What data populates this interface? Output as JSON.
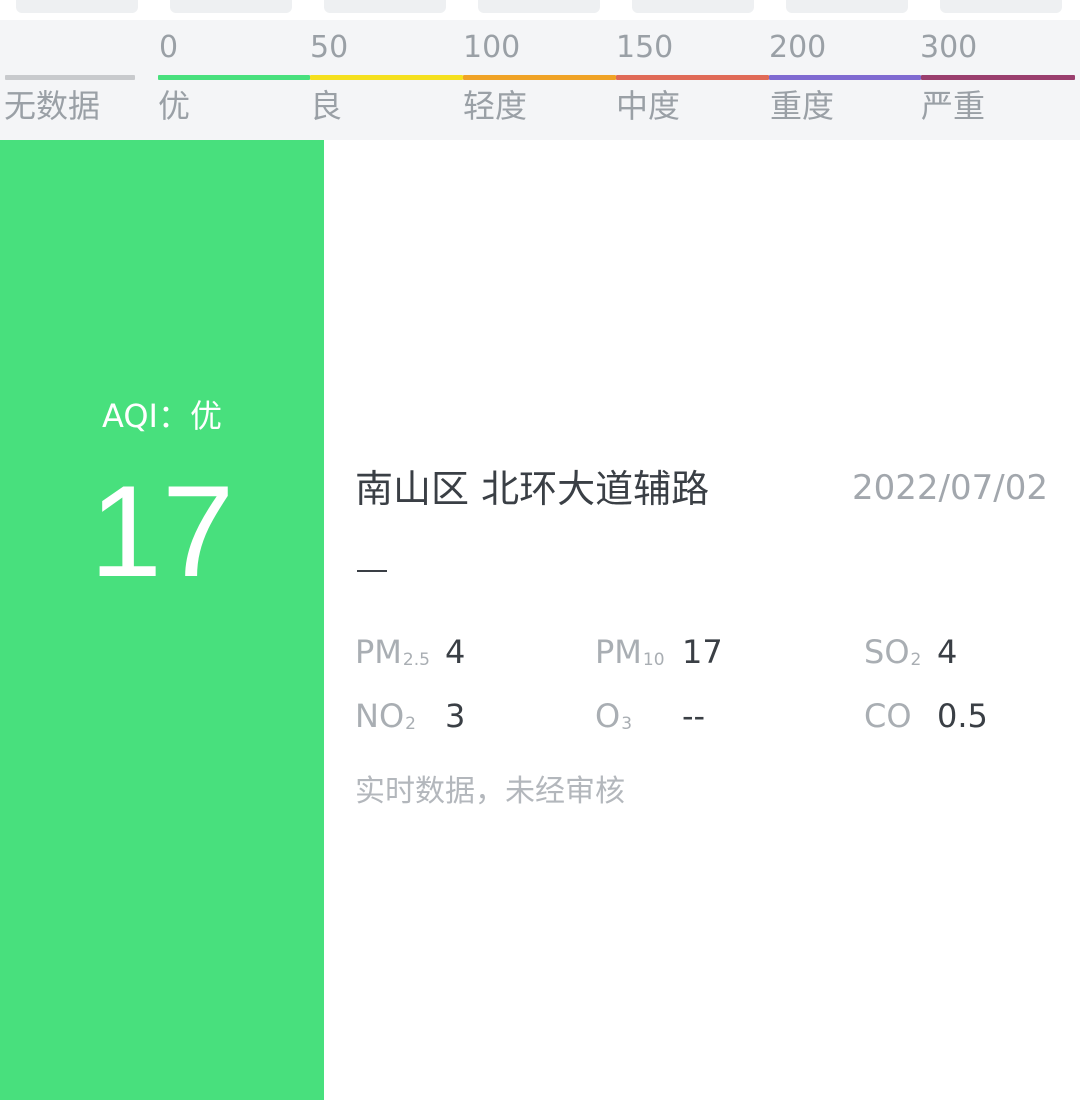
{
  "legend": {
    "numbers": [
      "0",
      "50",
      "100",
      "150",
      "200",
      "300"
    ],
    "levels": [
      "无数据",
      "优",
      "良",
      "轻度",
      "中度",
      "重度",
      "严重"
    ],
    "colors": [
      "#c8cacd",
      "#48e07d",
      "#f5e01e",
      "#f0a326",
      "#e06a57",
      "#7f6ad1",
      "#9a3f6e"
    ]
  },
  "aqi": {
    "label": "AQI：优",
    "value": "17",
    "color": "#48e07d"
  },
  "station": {
    "name": "南山区 北环大道辅路",
    "date": "2022/07/02"
  },
  "pollutants": [
    {
      "name": "PM",
      "sub": "2.5",
      "value": "4"
    },
    {
      "name": "PM",
      "sub": "10",
      "value": "17"
    },
    {
      "name": "SO",
      "sub": "2",
      "value": "4"
    },
    {
      "name": "NO",
      "sub": "2",
      "value": "3"
    },
    {
      "name": "O",
      "sub": "3",
      "value": "--"
    },
    {
      "name": "CO",
      "sub": "",
      "value": "0.5"
    }
  ],
  "note": "实时数据，未经审核"
}
